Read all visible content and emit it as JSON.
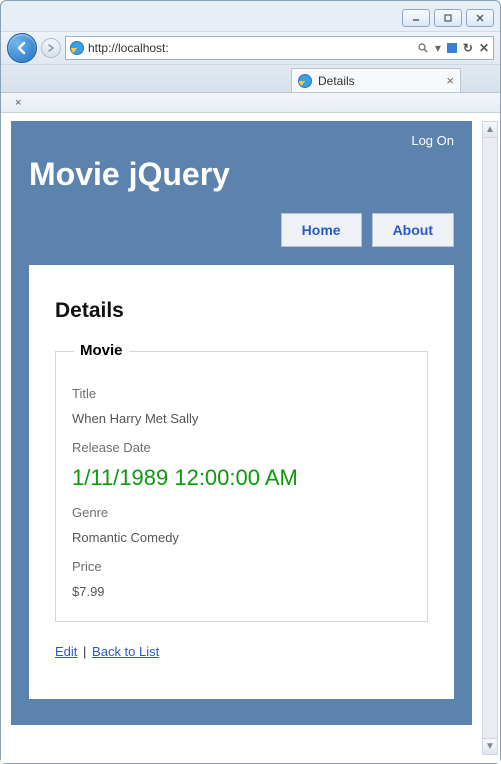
{
  "browser": {
    "address": "http://localhost:",
    "search_hint": "",
    "tab_title": "Details"
  },
  "site": {
    "title": "Movie jQuery",
    "logon_label": "Log On",
    "menu": {
      "home": "Home",
      "about": "About"
    }
  },
  "page": {
    "heading": "Details",
    "legend": "Movie",
    "labels": {
      "title": "Title",
      "release": "Release Date",
      "genre": "Genre",
      "price": "Price"
    },
    "values": {
      "title": "When Harry Met Sally",
      "release": "1/11/1989 12:00:00 AM",
      "genre": "Romantic Comedy",
      "price": "$7.99"
    },
    "links": {
      "edit": "Edit",
      "back": "Back to List"
    }
  }
}
